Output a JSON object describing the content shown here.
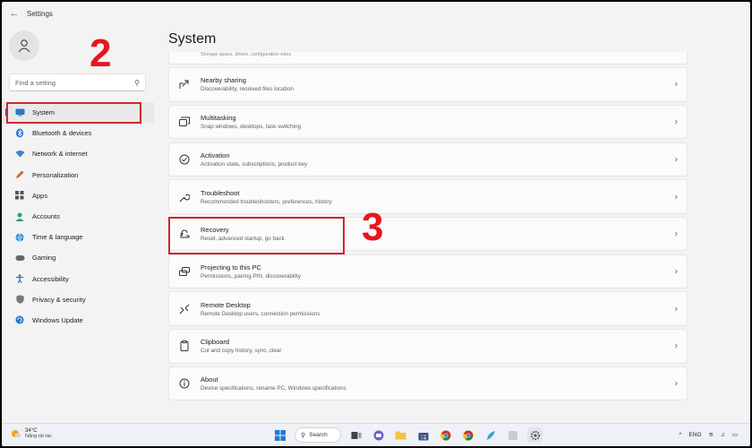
{
  "window": {
    "title": "Settings"
  },
  "search": {
    "placeholder": "Find a setting"
  },
  "sidebar": {
    "items": [
      {
        "label": "System",
        "icon": "monitor-icon"
      },
      {
        "label": "Bluetooth & devices",
        "icon": "bluetooth-icon"
      },
      {
        "label": "Network & internet",
        "icon": "wifi-icon"
      },
      {
        "label": "Personalization",
        "icon": "pencil-icon"
      },
      {
        "label": "Apps",
        "icon": "apps-icon"
      },
      {
        "label": "Accounts",
        "icon": "person-icon"
      },
      {
        "label": "Time & language",
        "icon": "globe-icon"
      },
      {
        "label": "Gaming",
        "icon": "gamepad-icon"
      },
      {
        "label": "Accessibility",
        "icon": "accessibility-icon"
      },
      {
        "label": "Privacy & security",
        "icon": "shield-icon"
      },
      {
        "label": "Windows Update",
        "icon": "update-icon"
      }
    ]
  },
  "main": {
    "title": "System",
    "partial_card_desc": "Storage space, drives, configuration rules",
    "cards": [
      {
        "title": "Nearby sharing",
        "desc": "Discoverability, received files location",
        "icon": "share-icon"
      },
      {
        "title": "Multitasking",
        "desc": "Snap windows, desktops, task switching",
        "icon": "multitasking-icon"
      },
      {
        "title": "Activation",
        "desc": "Activation state, subscriptions, product key",
        "icon": "check-circle-icon"
      },
      {
        "title": "Troubleshoot",
        "desc": "Recommended troubleshooters, preferences, history",
        "icon": "wrench-icon"
      },
      {
        "title": "Recovery",
        "desc": "Reset, advanced startup, go back",
        "icon": "recovery-icon"
      },
      {
        "title": "Projecting to this PC",
        "desc": "Permissions, pairing PIN, discoverability",
        "icon": "projector-icon"
      },
      {
        "title": "Remote Desktop",
        "desc": "Remote Desktop users, connection permissions",
        "icon": "remote-desktop-icon"
      },
      {
        "title": "Clipboard",
        "desc": "Cut and copy history, sync, clear",
        "icon": "clipboard-icon"
      },
      {
        "title": "About",
        "desc": "Device specifications, rename PC, Windows specifications",
        "icon": "info-icon"
      }
    ]
  },
  "annotations": {
    "step2": "2",
    "step3": "3"
  },
  "taskbar": {
    "weather_temp": "34°C",
    "weather_cond": "Nắng rải rác",
    "search_label": "Search",
    "lang": "ENG"
  },
  "colors": {
    "accent": "#0067c0",
    "highlight": "#d0262c",
    "step_number": "#e8161e"
  }
}
